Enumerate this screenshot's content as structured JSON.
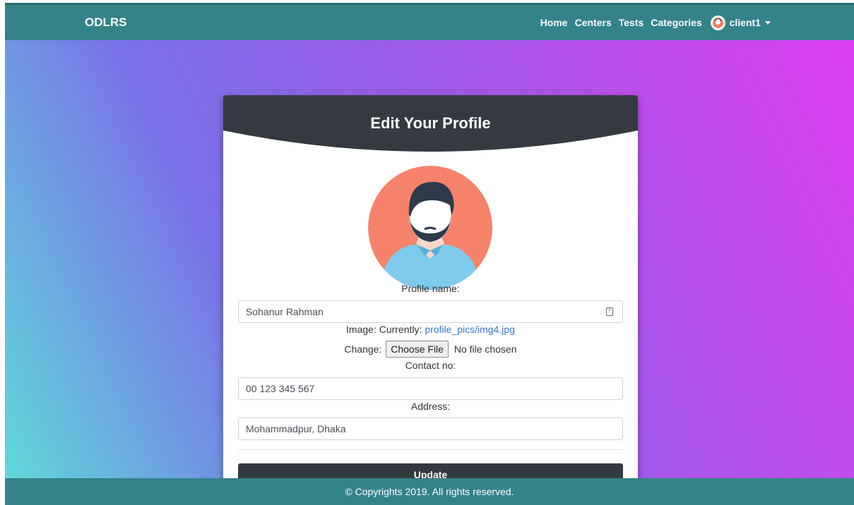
{
  "navbar": {
    "brand": "ODLRS",
    "links": [
      "Home",
      "Centers",
      "Tests",
      "Categories"
    ],
    "user": "client1",
    "user_icon": "user-avatar-icon",
    "caret_icon": "caret-down-icon"
  },
  "card": {
    "title": "Edit Your Profile",
    "avatar_icon": "profile-avatar-image",
    "profile_label": "Profile name:",
    "profile_value": "Sohanur Rahman",
    "profile_field_icon": "autofill-icon",
    "image_label": "Image: Currently:",
    "image_link": "profile_pics/img4.jpg",
    "change_label": "Change:",
    "choose_file": "Choose File",
    "no_file": "No file chosen",
    "contact_label": "Contact no:",
    "contact_value": "00 123 345 567",
    "address_label": "Address:",
    "address_value": "Mohammadpur, Dhaka",
    "update_button": "Update"
  },
  "footer": {
    "text": "© Copyrights 2019. All rights reserved."
  },
  "colors": {
    "navbar": "#338389",
    "card_header": "#343a40",
    "button": "#343a40",
    "link": "#3578c9"
  }
}
